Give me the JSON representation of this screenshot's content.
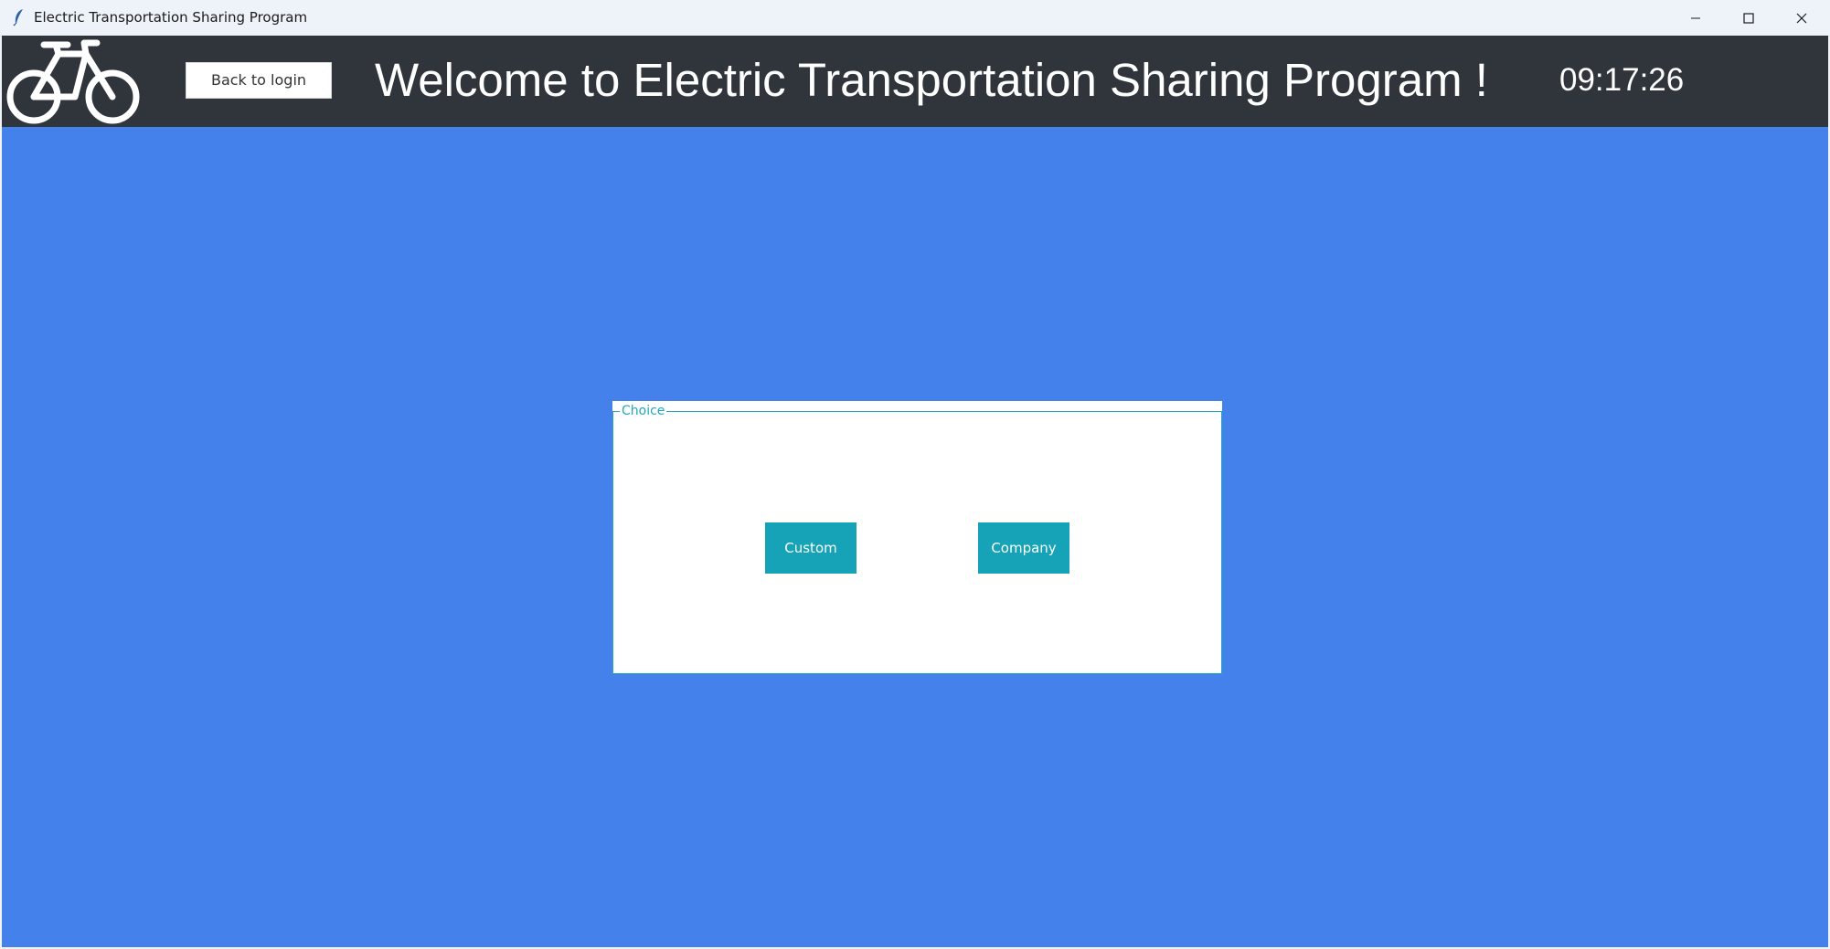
{
  "window": {
    "title": "Electric Transportation Sharing Program"
  },
  "header": {
    "logo_icon": "bicycle-icon",
    "back_button_label": "Back to login",
    "welcome_text": "Welcome to Electric Transportation Sharing Program !",
    "clock": "09:17:26"
  },
  "choice": {
    "legend": "Choice",
    "custom_label": "Custom",
    "company_label": "Company"
  },
  "colors": {
    "header_bg": "#30353c",
    "main_bg": "#4581ea",
    "accent": "#16a3b7",
    "frame": "#22a8b8"
  }
}
